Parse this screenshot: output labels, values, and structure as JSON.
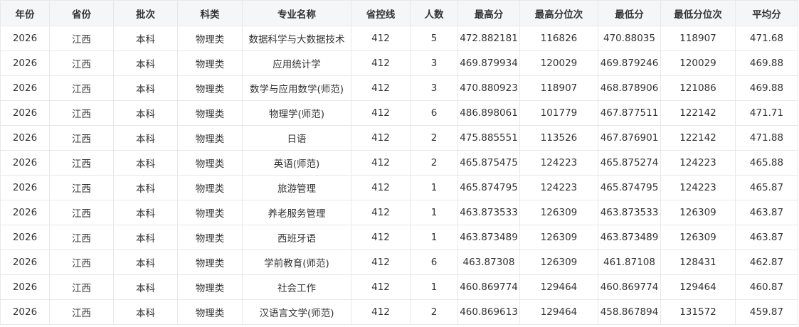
{
  "table": {
    "headers": [
      "年份",
      "省份",
      "批次",
      "科类",
      "专业名称",
      "省控线",
      "人数",
      "最高分",
      "最高分位次",
      "最低分",
      "最低分位次",
      "平均分"
    ],
    "rows": [
      [
        "2026",
        "江西",
        "本科",
        "物理类",
        "数据科学与大数据技术",
        "412",
        "5",
        "472.882181",
        "116826",
        "470.88035",
        "118907",
        "471.68"
      ],
      [
        "2026",
        "江西",
        "本科",
        "物理类",
        "应用统计学",
        "412",
        "3",
        "469.879934",
        "120029",
        "469.879246",
        "120029",
        "469.88"
      ],
      [
        "2026",
        "江西",
        "本科",
        "物理类",
        "数学与应用数学(师范)",
        "412",
        "3",
        "470.880923",
        "118907",
        "468.878906",
        "121086",
        "469.88"
      ],
      [
        "2026",
        "江西",
        "本科",
        "物理类",
        "物理学(师范)",
        "412",
        "6",
        "486.898061",
        "101779",
        "467.877511",
        "122142",
        "471.71"
      ],
      [
        "2026",
        "江西",
        "本科",
        "物理类",
        "日语",
        "412",
        "2",
        "475.885551",
        "113526",
        "467.876901",
        "122142",
        "471.88"
      ],
      [
        "2026",
        "江西",
        "本科",
        "物理类",
        "英语(师范)",
        "412",
        "2",
        "465.875475",
        "124223",
        "465.875274",
        "124223",
        "465.88"
      ],
      [
        "2026",
        "江西",
        "本科",
        "物理类",
        "旅游管理",
        "412",
        "1",
        "465.874795",
        "124223",
        "465.874795",
        "124223",
        "465.87"
      ],
      [
        "2026",
        "江西",
        "本科",
        "物理类",
        "养老服务管理",
        "412",
        "1",
        "463.873533",
        "126309",
        "463.873533",
        "126309",
        "463.87"
      ],
      [
        "2026",
        "江西",
        "本科",
        "物理类",
        "西班牙语",
        "412",
        "1",
        "463.873489",
        "126309",
        "463.873489",
        "126309",
        "463.87"
      ],
      [
        "2026",
        "江西",
        "本科",
        "物理类",
        "学前教育(师范)",
        "412",
        "6",
        "463.87308",
        "126309",
        "461.87108",
        "128431",
        "462.87"
      ],
      [
        "2026",
        "江西",
        "本科",
        "物理类",
        "社会工作",
        "412",
        "1",
        "460.869774",
        "129464",
        "460.869774",
        "129464",
        "460.87"
      ],
      [
        "2026",
        "江西",
        "本科",
        "物理类",
        "汉语言文学(师范)",
        "412",
        "2",
        "460.869613",
        "129464",
        "458.867894",
        "131572",
        "459.87"
      ]
    ]
  }
}
